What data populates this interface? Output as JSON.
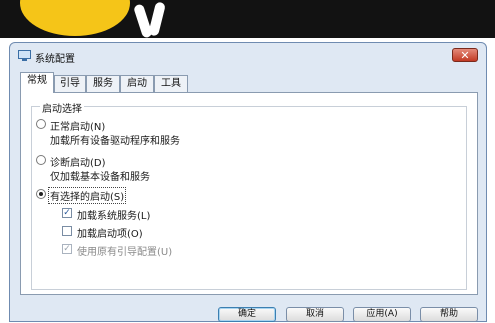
{
  "window": {
    "title": "系统配置",
    "close_label": "✕"
  },
  "tabs": [
    {
      "label": "常规"
    },
    {
      "label": "引导"
    },
    {
      "label": "服务"
    },
    {
      "label": "启动"
    },
    {
      "label": "工具"
    }
  ],
  "active_tab": "常规",
  "startup_selection": {
    "group_title": "启动选择",
    "options": [
      {
        "label": "正常启动(N)",
        "description": "加载所有设备驱动程序和服务",
        "selected": false
      },
      {
        "label": "诊断启动(D)",
        "description": "仅加载基本设备和服务",
        "selected": false
      },
      {
        "label": "有选择的启动(S)",
        "selected": true
      }
    ],
    "sub_options": [
      {
        "label": "加载系统服务(L)",
        "checked": true,
        "enabled": true
      },
      {
        "label": "加载启动项(O)",
        "checked": false,
        "enabled": true
      },
      {
        "label": "使用原有引导配置(U)",
        "checked": true,
        "enabled": false
      }
    ]
  },
  "buttons": {
    "ok": "确定",
    "cancel": "取消",
    "apply": "应用(A)",
    "help": "帮助"
  },
  "colors": {
    "banner": "#121212",
    "accent": "#f5c518",
    "window": "#dfe8f3",
    "close": "#c23a24"
  }
}
